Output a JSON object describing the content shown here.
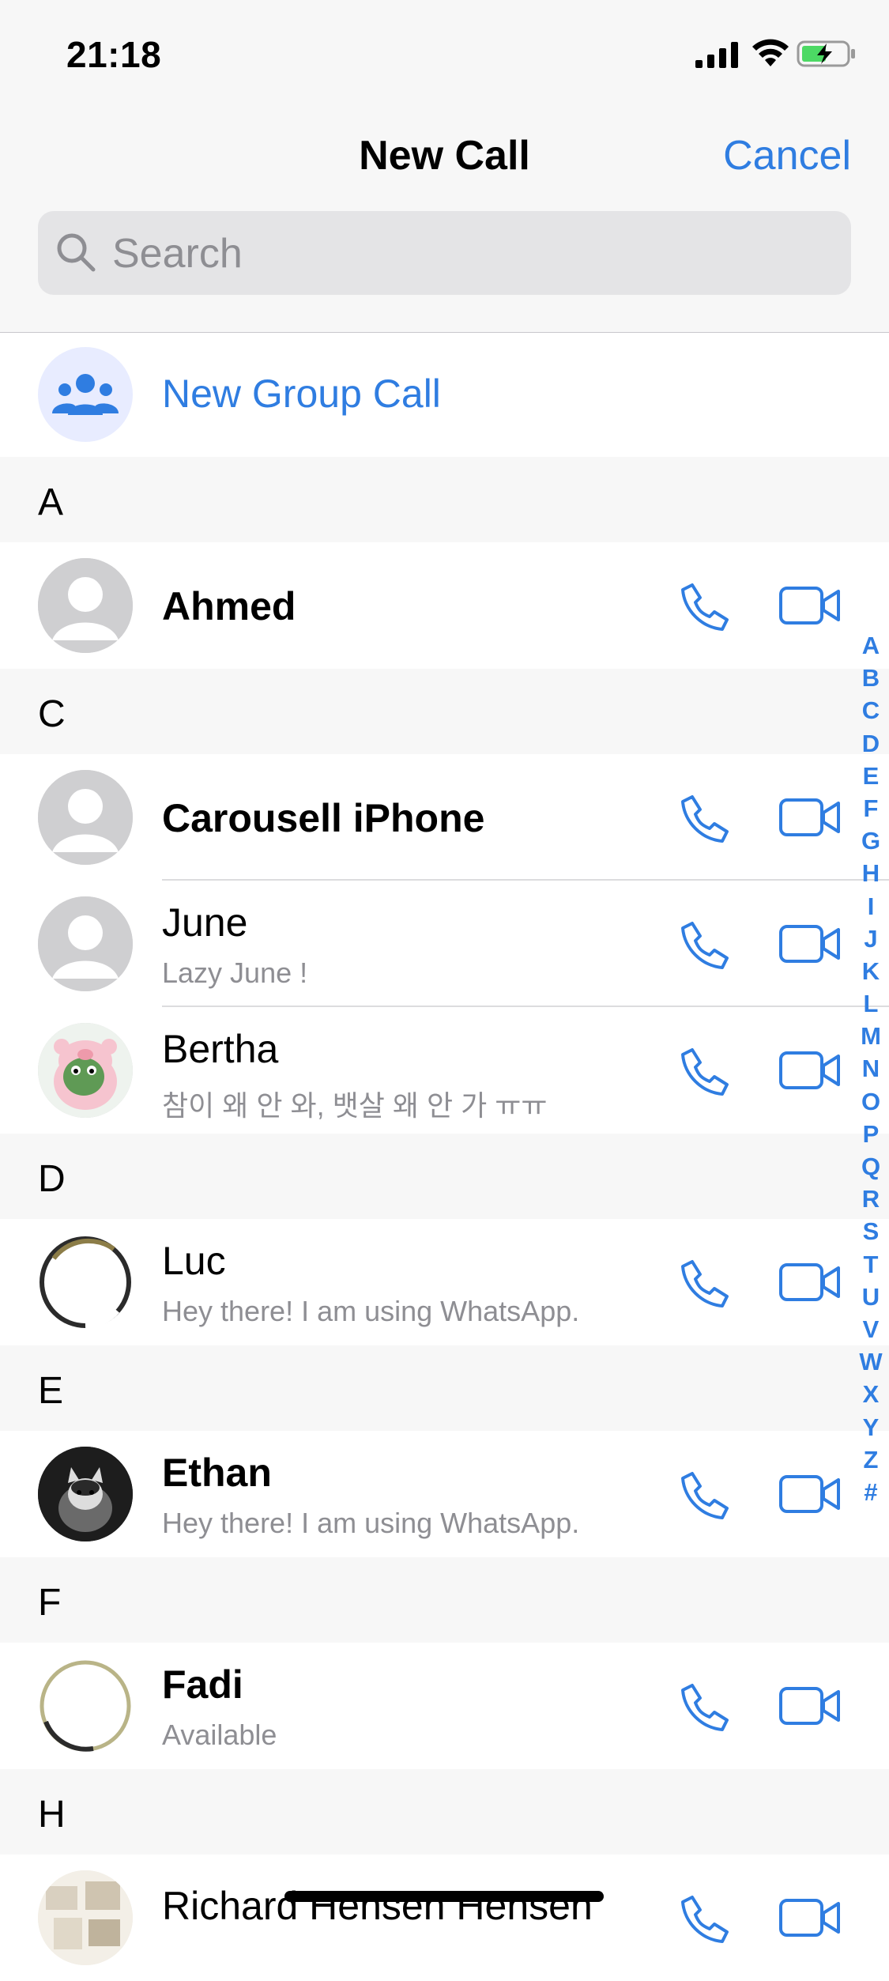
{
  "status_bar": {
    "time": "21:18"
  },
  "nav": {
    "title": "New Call",
    "cancel_label": "Cancel"
  },
  "search": {
    "placeholder": "Search",
    "value": ""
  },
  "new_group_call": {
    "label": "New Group Call"
  },
  "sections": [
    {
      "letter": "A",
      "contacts": [
        {
          "name": "Ahmed",
          "subtitle": ""
        }
      ]
    },
    {
      "letter": "C",
      "contacts": [
        {
          "name": "Carousell iPhone",
          "subtitle": ""
        },
        {
          "name": "June",
          "subtitle": "Lazy June !"
        },
        {
          "name": "Bertha",
          "subtitle": "참이 왜 안 와, 뱃살 왜 안 가 ㅠㅠ"
        }
      ]
    },
    {
      "letter": "D",
      "contacts": [
        {
          "name": "Luc",
          "subtitle": "Hey there! I am using WhatsApp."
        }
      ]
    },
    {
      "letter": "E",
      "contacts": [
        {
          "name": "Ethan",
          "subtitle": "Hey there! I am using WhatsApp."
        }
      ]
    },
    {
      "letter": "F",
      "contacts": [
        {
          "name": "Fadi",
          "subtitle": "Available"
        }
      ]
    },
    {
      "letter": "H",
      "contacts": [
        {
          "name": "Richard Hensen Hensen",
          "subtitle": ""
        }
      ]
    }
  ],
  "index_letters": [
    "A",
    "B",
    "C",
    "D",
    "E",
    "F",
    "G",
    "H",
    "I",
    "J",
    "K",
    "L",
    "M",
    "N",
    "O",
    "P",
    "Q",
    "R",
    "S",
    "T",
    "U",
    "V",
    "W",
    "X",
    "Y",
    "Z",
    "#"
  ],
  "icons": {
    "call": "phone-icon",
    "video": "video-camera-icon",
    "search": "magnifier-icon",
    "group": "people-icon"
  },
  "colors": {
    "accent": "#2f7de1",
    "background": "#f7f7f7",
    "secondary_text": "#8e8e93"
  }
}
